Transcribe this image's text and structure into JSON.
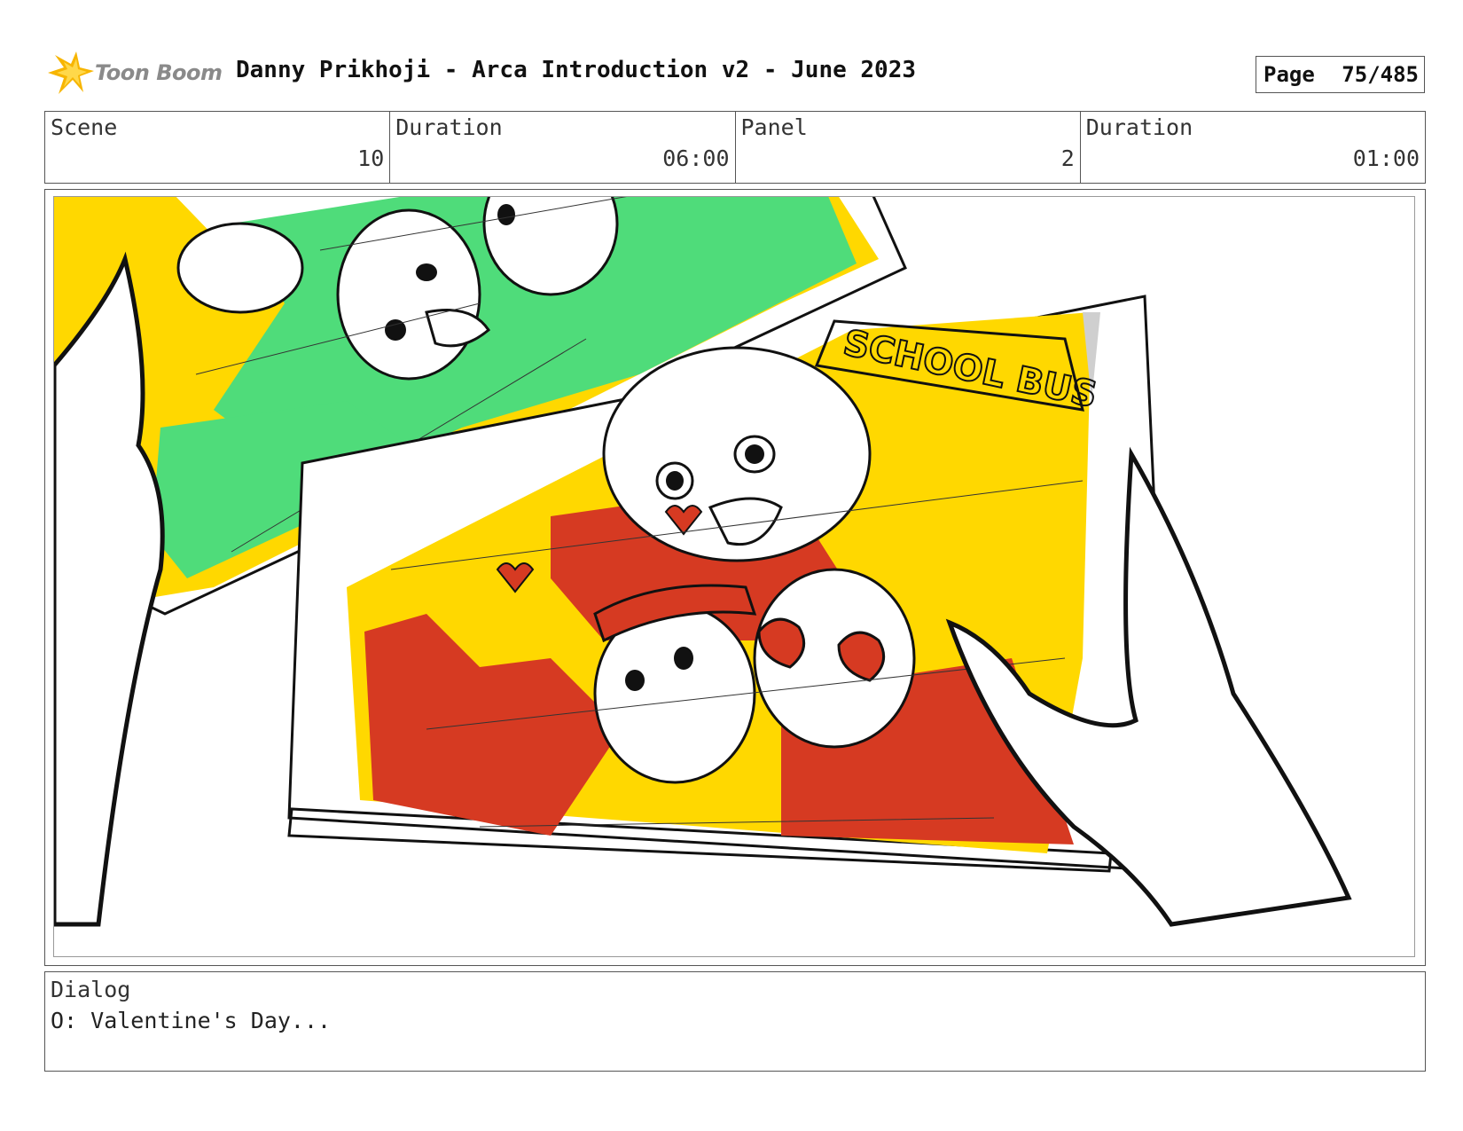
{
  "header": {
    "logo_text": "Toon Boom",
    "title": "Danny Prikhoji - Arca Introduction v2 - June 2023",
    "page_label": "Page",
    "page_value": "75/485"
  },
  "info": {
    "scene_label": "Scene",
    "scene_value": "10",
    "scene_duration_label": "Duration",
    "scene_duration_value": "06:00",
    "panel_label": "Panel",
    "panel_value": "2",
    "panel_duration_label": "Duration",
    "panel_duration_value": "01:00"
  },
  "artwork": {
    "sign_text": "SCHOOL BUS",
    "colors": {
      "yellow": "#FFD800",
      "green": "#4FDC7A",
      "red": "#D63A22",
      "ink": "#111111"
    }
  },
  "dialog": {
    "label": "Dialog",
    "text": "O: Valentine's Day..."
  }
}
